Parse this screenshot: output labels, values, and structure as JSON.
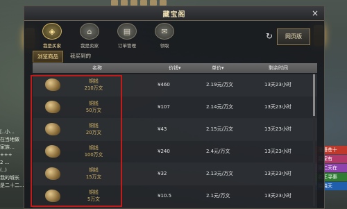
{
  "window": {
    "title": "藏宝阁",
    "close": "×"
  },
  "nav": [
    {
      "label": "我是买家",
      "icon": "buyer-icon",
      "glyph": "◈"
    },
    {
      "label": "我是卖家",
      "icon": "shop-icon",
      "glyph": "⌂"
    },
    {
      "label": "订单管理",
      "icon": "order-icon",
      "glyph": "▤"
    },
    {
      "label": "领取",
      "icon": "mail-icon",
      "glyph": "✉"
    }
  ],
  "toolbar": {
    "refresh_icon": "refresh-icon",
    "web_label": "网页版"
  },
  "subtabs": [
    "浏览商品",
    "我买到的"
  ],
  "table": {
    "headers": {
      "name": "名称",
      "price": "价钱",
      "unit": "单价",
      "time": "剩余时间"
    },
    "rows": [
      {
        "item": "铜钱",
        "amount": "210万文",
        "price": "¥460",
        "unit": "2.19元/万文",
        "time": "13天23小时"
      },
      {
        "item": "铜钱",
        "amount": "50万文",
        "price": "¥107",
        "unit": "2.14元/万文",
        "time": "13天23小时"
      },
      {
        "item": "铜钱",
        "amount": "20万文",
        "price": "¥43",
        "unit": "2.15元/万文",
        "time": "13天23小时"
      },
      {
        "item": "铜钱",
        "amount": "100万文",
        "price": "¥240",
        "unit": "2.4元/万文",
        "time": "13天23小时"
      },
      {
        "item": "铜钱",
        "amount": "15万文",
        "price": "¥32",
        "unit": "2.13元/万文",
        "time": "13天23小时"
      },
      {
        "item": "铜钱",
        "amount": "5万文",
        "price": "¥10.5",
        "unit": "2.1元/万文",
        "time": "13天23小时"
      }
    ]
  },
  "background": {
    "chat": [
      "[..小...",
      "在当地做",
      "家族…",
      "+++",
      "2 ...",
      "(..)",
      "我的城长",
      "是二十二..."
    ],
    "right_list": [
      {
        "text": "漫语苍十",
        "color": "#c0392b"
      },
      {
        "text": "我家有",
        "color": "#b23a6a"
      },
      {
        "text": "第二天在",
        "color": "#8e44ad"
      },
      {
        "text": "老王寻秦",
        "color": "#2e7d32"
      },
      {
        "text": "晓晓天",
        "color": "#1f5fae"
      }
    ]
  }
}
